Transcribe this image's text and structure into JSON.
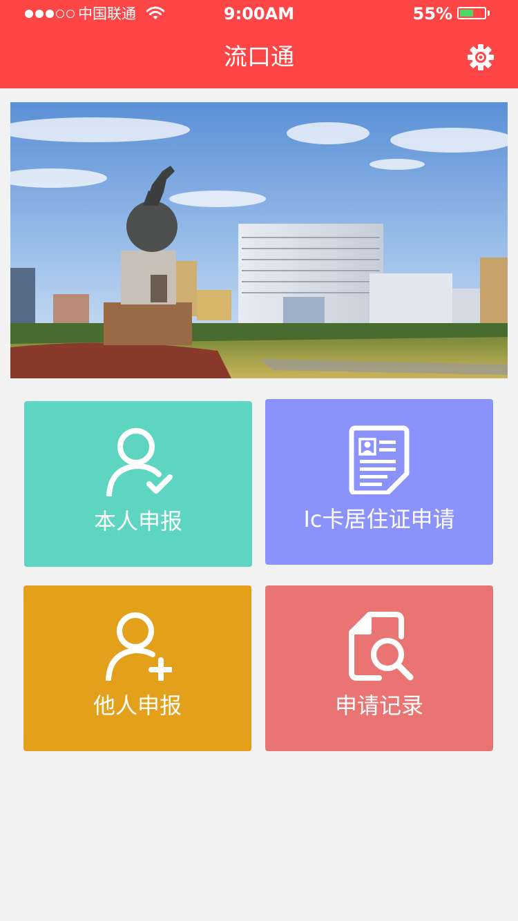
{
  "status_bar": {
    "carrier": "中国联通",
    "time": "9:00AM",
    "battery": "55%",
    "signal_bars_filled": 3,
    "signal_bars_total": 5,
    "battery_level": 0.55
  },
  "header": {
    "title": "流口通",
    "settings_icon": "gear-icon"
  },
  "banner": {
    "image": "city-square-statue-photo"
  },
  "tiles": [
    {
      "label": "本人申报",
      "color": "#5dd5c0",
      "icon": "user-check-icon"
    },
    {
      "label": "Ic卡居住证申请",
      "color": "#8c92fb",
      "icon": "id-card-document-icon"
    },
    {
      "label": "他人申报",
      "color": "#e2a01b",
      "icon": "user-add-icon"
    },
    {
      "label": "申请记录",
      "color": "#ea7474",
      "icon": "document-search-icon"
    }
  ],
  "colors": {
    "header": "#ff4646",
    "background": "#f2f2f2",
    "battery_fill": "#4cd964"
  }
}
